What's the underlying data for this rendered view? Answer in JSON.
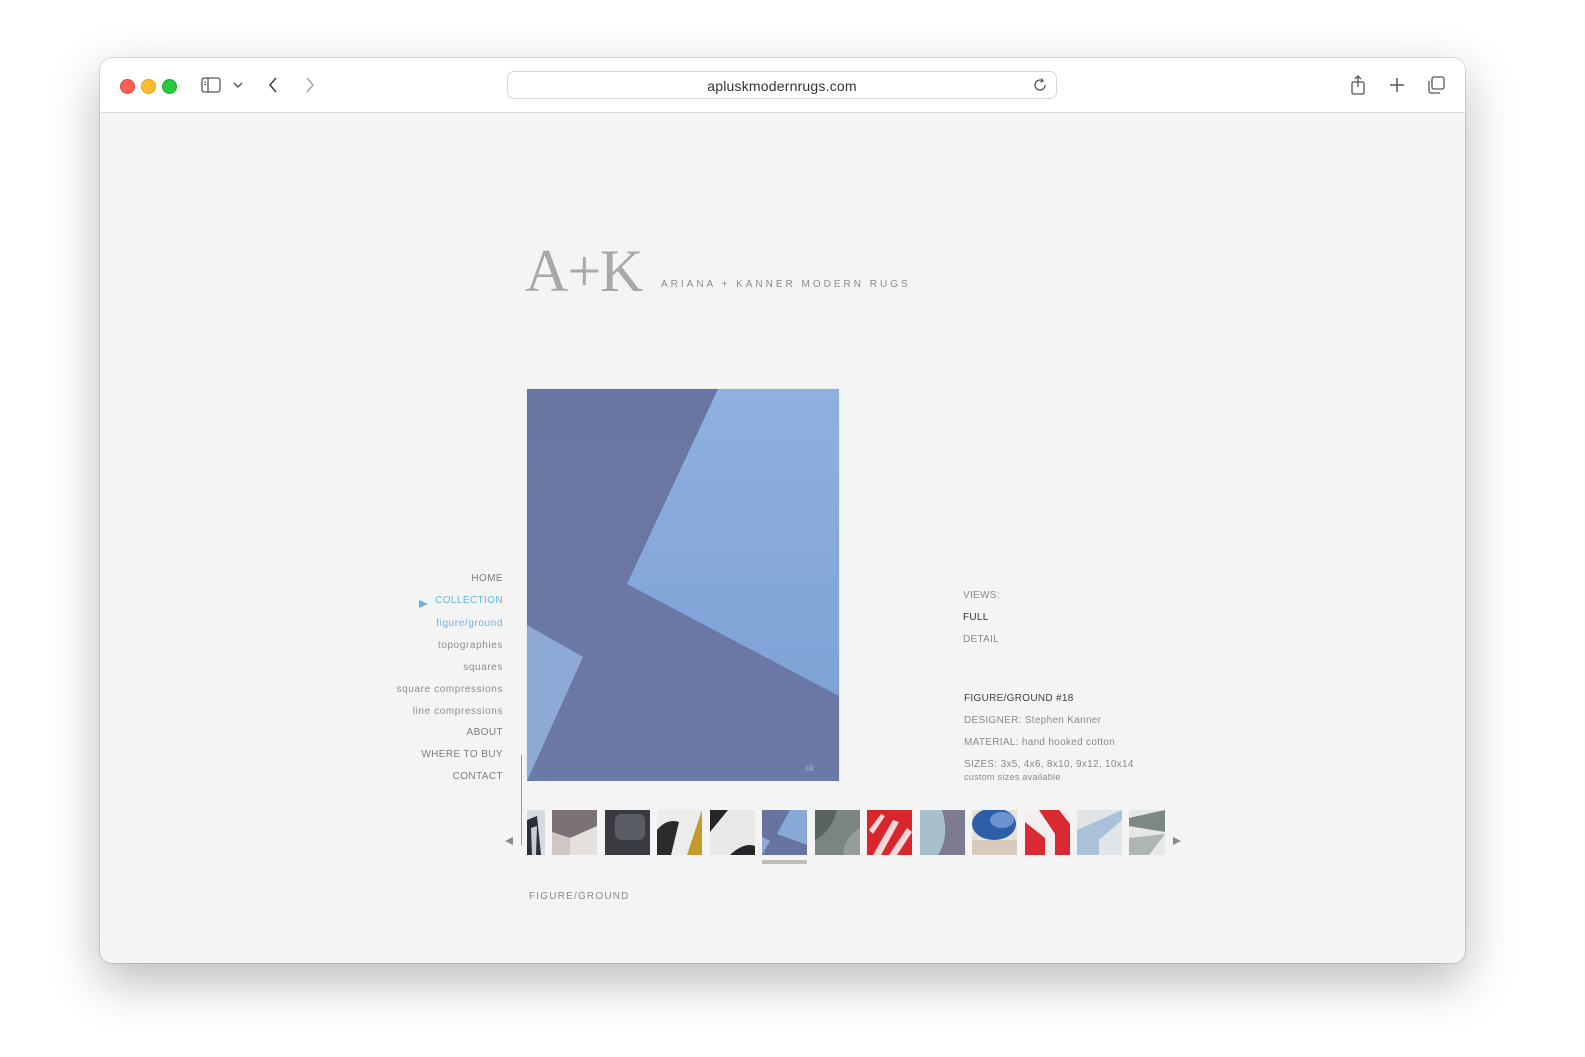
{
  "browser": {
    "url": "apluskmodernrugs.com"
  },
  "brand": {
    "mark": "A+K",
    "tagline": "ARIANA + KANNER MODERN RUGS"
  },
  "nav": {
    "home": "HOME",
    "collection": "COLLECTION",
    "sub_items": [
      "figure/ground",
      "topographies",
      "squares",
      "square compressions",
      "line compressions"
    ],
    "about": "ABOUT",
    "where_to_buy": "WHERE TO BUY",
    "contact": "CONTACT"
  },
  "views": {
    "label": "VIEWS:",
    "full": "FULL",
    "detail": "DETAIL"
  },
  "product": {
    "title": "FIGURE/GROUND #18",
    "designer_label": "DESIGNER:",
    "designer": "Stephen Kanner",
    "material_label": "MATERIAL:",
    "material": "hand hooked cotton",
    "sizes_label": "SIZES:",
    "sizes": "3x5, 4x6, 8x10, 9x12, 10x14",
    "custom_note": "custom sizes available"
  },
  "colors": {
    "rug_dark": "#6874a0",
    "rug_light": "#89a8d8",
    "accent": "#6ab3e3"
  },
  "thumbnails": {
    "selected_index": 5,
    "count": 13
  },
  "collection_label": "FIGURE/GROUND"
}
